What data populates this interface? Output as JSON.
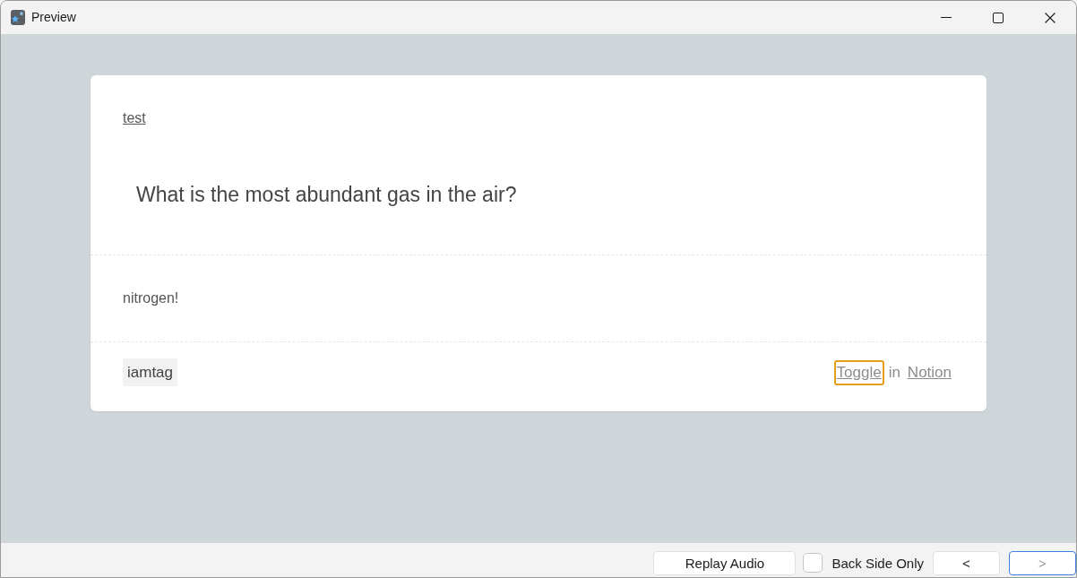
{
  "window": {
    "title": "Preview"
  },
  "card": {
    "deck_link": "test",
    "question": "What is the most abundant gas in the air?",
    "answer": "nitrogen!",
    "tags": [
      "iamtag"
    ],
    "footer": {
      "toggle_link": {
        "label": "Toggle",
        "focused": true
      },
      "connector": "in",
      "notion_link": "Notion"
    }
  },
  "bottom_bar": {
    "replay_button": "Replay Audio",
    "back_side_only": {
      "label": "Back Side Only",
      "checked": false
    },
    "prev_button": {
      "label": "<",
      "disabled": false,
      "focused": false
    },
    "next_button": {
      "label": ">",
      "disabled": true,
      "focused": true
    }
  }
}
